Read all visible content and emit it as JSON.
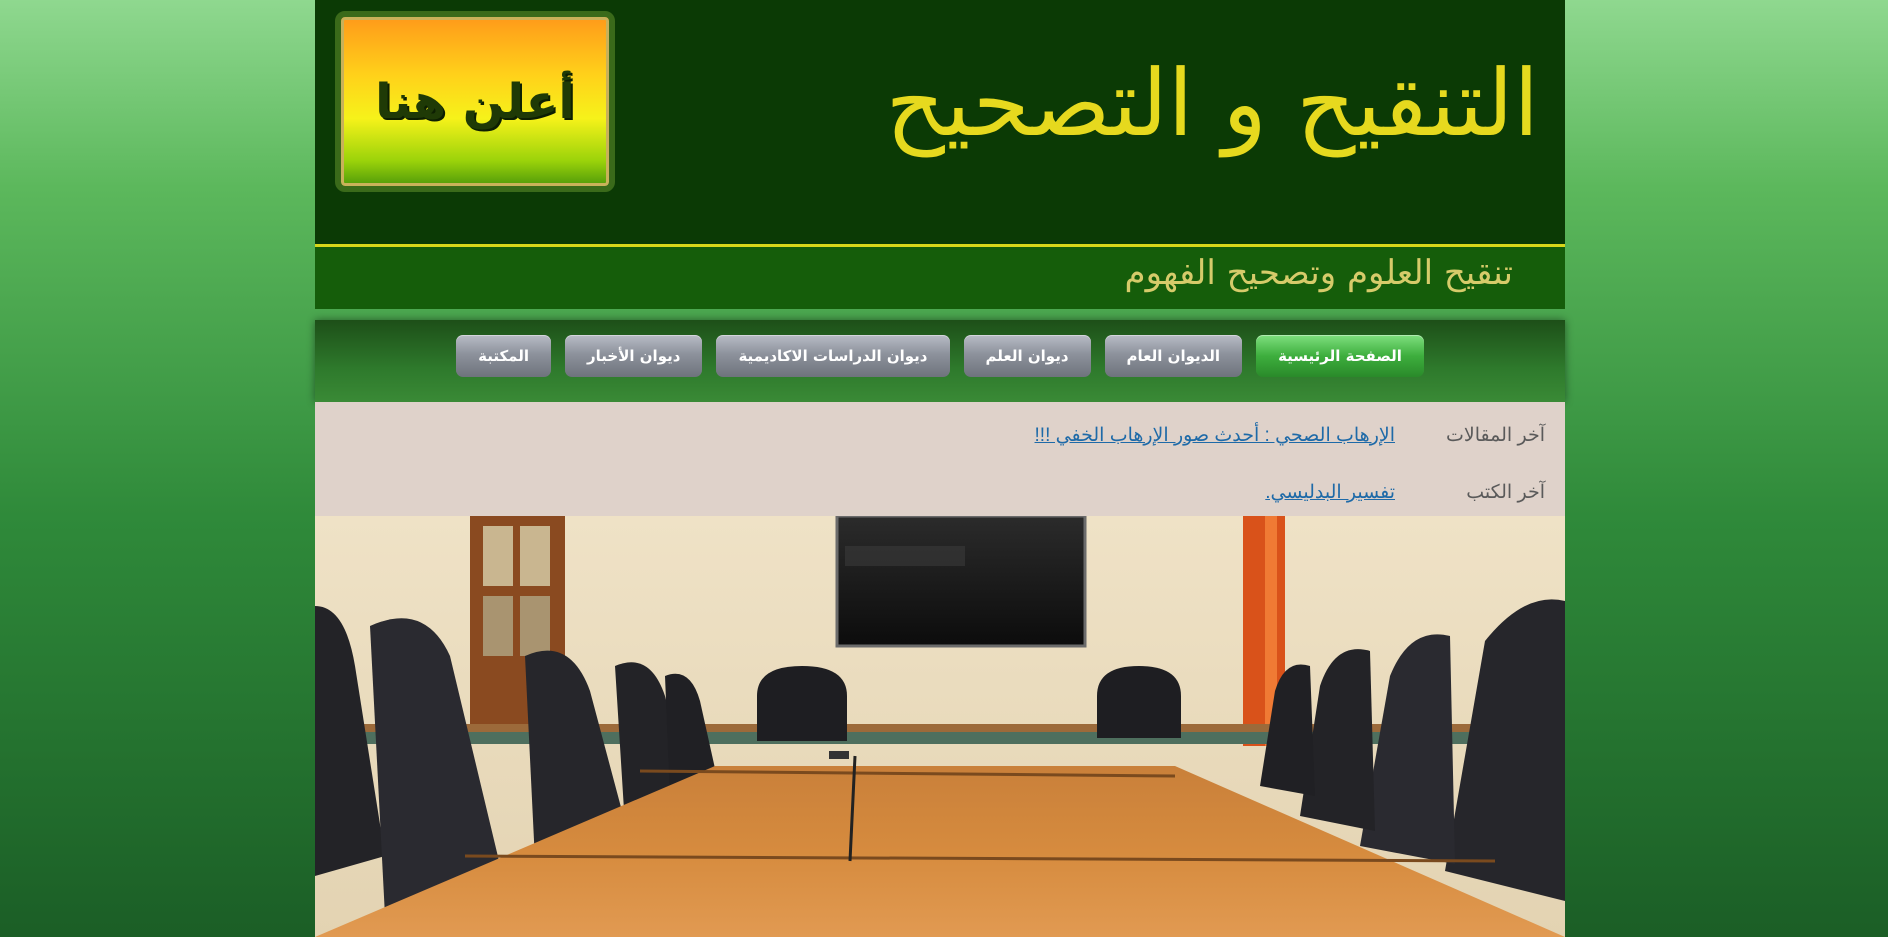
{
  "header": {
    "ad_text": "أعلن هنا",
    "site_title": "التنقيح و التصحيح",
    "tagline": "تنقيح العلوم وتصحيح الفهوم"
  },
  "nav": {
    "items": [
      {
        "label": "الصفحة الرئيسية",
        "active": true
      },
      {
        "label": "الديوان العام",
        "active": false
      },
      {
        "label": "ديوان العلم",
        "active": false
      },
      {
        "label": "ديوان الدراسات الاكاديمية",
        "active": false
      },
      {
        "label": "ديوان الأخبار",
        "active": false
      },
      {
        "label": "المكتبة",
        "active": false
      }
    ]
  },
  "latest": {
    "articles_label": "آخر المقالات",
    "articles_link": "الإرهاب الصحي : أحدث صور الإرهاب الخفي !!!",
    "books_label": "آخر الكتب",
    "books_link": "تفسير البدليسي."
  },
  "colors": {
    "header_bg": "#0b3a05",
    "title_yellow": "#e6d91e",
    "nav_active": "#3dae3d",
    "link_blue": "#1e6aa8"
  }
}
